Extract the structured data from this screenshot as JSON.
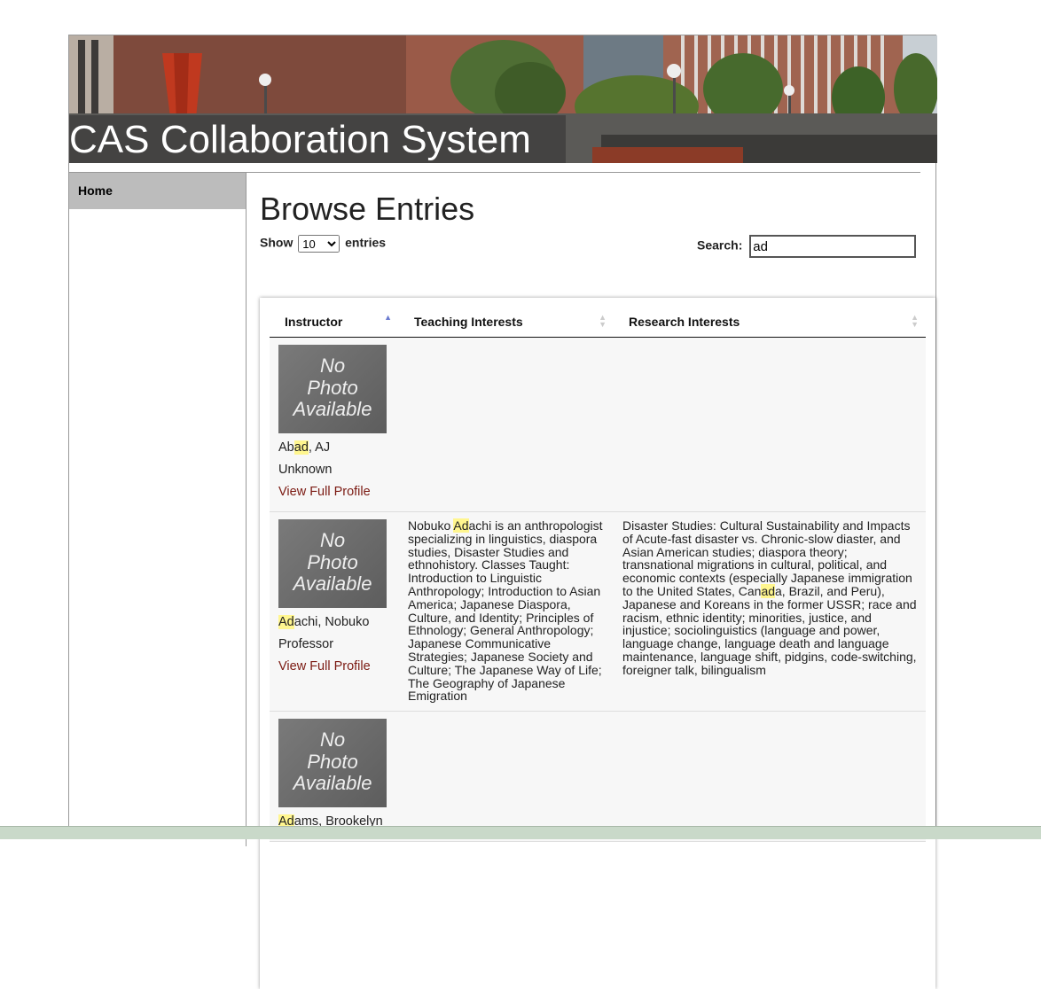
{
  "site": {
    "title": "CAS Collaboration System"
  },
  "nav": {
    "home_label": "Home"
  },
  "main": {
    "heading": "Browse Entries",
    "length": {
      "prefix": "Show",
      "value": "10",
      "suffix": "entries",
      "options": [
        "10"
      ]
    },
    "search": {
      "label": "Search:",
      "value": "ad"
    }
  },
  "table": {
    "headers": [
      "Instructor",
      "Teaching Interests",
      "Research Interests"
    ],
    "sort": {
      "column": "Instructor",
      "direction": "ascending"
    },
    "photo_placeholder": [
      "No",
      "Photo",
      "Available"
    ],
    "rows": [
      {
        "name_pre": "Ab",
        "name_hl": "ad",
        "name_post": ", AJ",
        "title": "Unknown",
        "profile_link": "View Full Profile",
        "teaching_pre": "",
        "teaching_hl": "",
        "teaching_post": "",
        "research_pre": "",
        "research_hl": "",
        "research_post": ""
      },
      {
        "name_pre": "",
        "name_hl": "Ad",
        "name_post": "achi, Nobuko",
        "title": "Professor",
        "profile_link": "View Full Profile",
        "teaching_pre": "Nobuko ",
        "teaching_hl": "Ad",
        "teaching_post": "achi is an anthropologist specializing in linguistics, diaspora studies, Disaster Studies and ethnohistory. Classes Taught: Introduction to Linguistic Anthropology; Introduction to Asian America; Japanese Diaspora, Culture, and Identity; Principles of Ethnology; General Anthropology; Japanese Communicative Strategies; Japanese Society and Culture; The Japanese Way of Life; The Geography of Japanese Emigration",
        "research_pre": "Disaster Studies: Cultural Sustainability and Impacts of Acute-fast disaster vs. Chronic-slow diaster, and Asian American studies; diaspora theory; transnational migrations in cultural, political, and economic contexts (especially Japanese immigration to the United States, Can",
        "research_hl": "ad",
        "research_post": "a, Brazil, and Peru), Japanese and Koreans in the former USSR; race and racism, ethnic identity; minorities, justice, and injustice; sociolinguistics (language and power, language change, language death and language maintenance, language shift, pidgins, code-switching, foreigner talk, bilingualism"
      },
      {
        "name_pre": "",
        "name_hl": "Ad",
        "name_post": "ams, Brookelyn",
        "title": "",
        "profile_link": "",
        "teaching_pre": "",
        "teaching_hl": "",
        "teaching_post": "",
        "research_pre": "",
        "research_hl": "",
        "research_post": ""
      }
    ]
  }
}
